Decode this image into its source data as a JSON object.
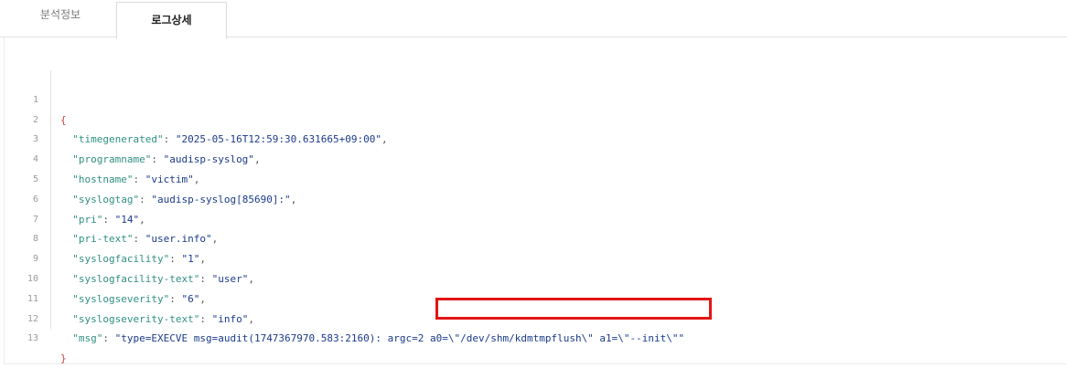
{
  "tabs": [
    {
      "label": "분석정보",
      "active": false
    },
    {
      "label": "로그상세",
      "active": true
    }
  ],
  "log": {
    "open_brace": "{",
    "close_brace": "}",
    "lines": [
      {
        "num": "1"
      },
      {
        "num": "2",
        "key": "\"timegenerated\"",
        "value": "\"2025-05-16T12:59:30.631665+09:00\""
      },
      {
        "num": "3",
        "key": "\"programname\"",
        "value": "\"audisp-syslog\""
      },
      {
        "num": "4",
        "key": "\"hostname\"",
        "value": "\"victim\""
      },
      {
        "num": "5",
        "key": "\"syslogtag\"",
        "value": "\"audisp-syslog[85690]:\""
      },
      {
        "num": "6",
        "key": "\"pri\"",
        "value": "\"14\""
      },
      {
        "num": "7",
        "key": "\"pri-text\"",
        "value": "\"user.info\""
      },
      {
        "num": "8",
        "key": "\"syslogfacility\"",
        "value": "\"1\""
      },
      {
        "num": "9",
        "key": "\"syslogfacility-text\"",
        "value": "\"user\""
      },
      {
        "num": "10",
        "key": "\"syslogseverity\"",
        "value": "\"6\""
      },
      {
        "num": "11",
        "key": "\"syslogseverity-text\"",
        "value": "\"info\""
      },
      {
        "num": "12",
        "key": "\"msg\"",
        "value": "\"type=EXECVE msg=audit(1747367970.583:2160): argc=2 a0=\\\"/dev/shm/kdmtmpflush\\\" a1=\\\"--init\\\"\""
      },
      {
        "num": "13"
      }
    ]
  },
  "colors": {
    "highlight": "#e31414",
    "key": "#2f8f83",
    "string": "#1a3a8a",
    "brace": "#c2443a"
  }
}
